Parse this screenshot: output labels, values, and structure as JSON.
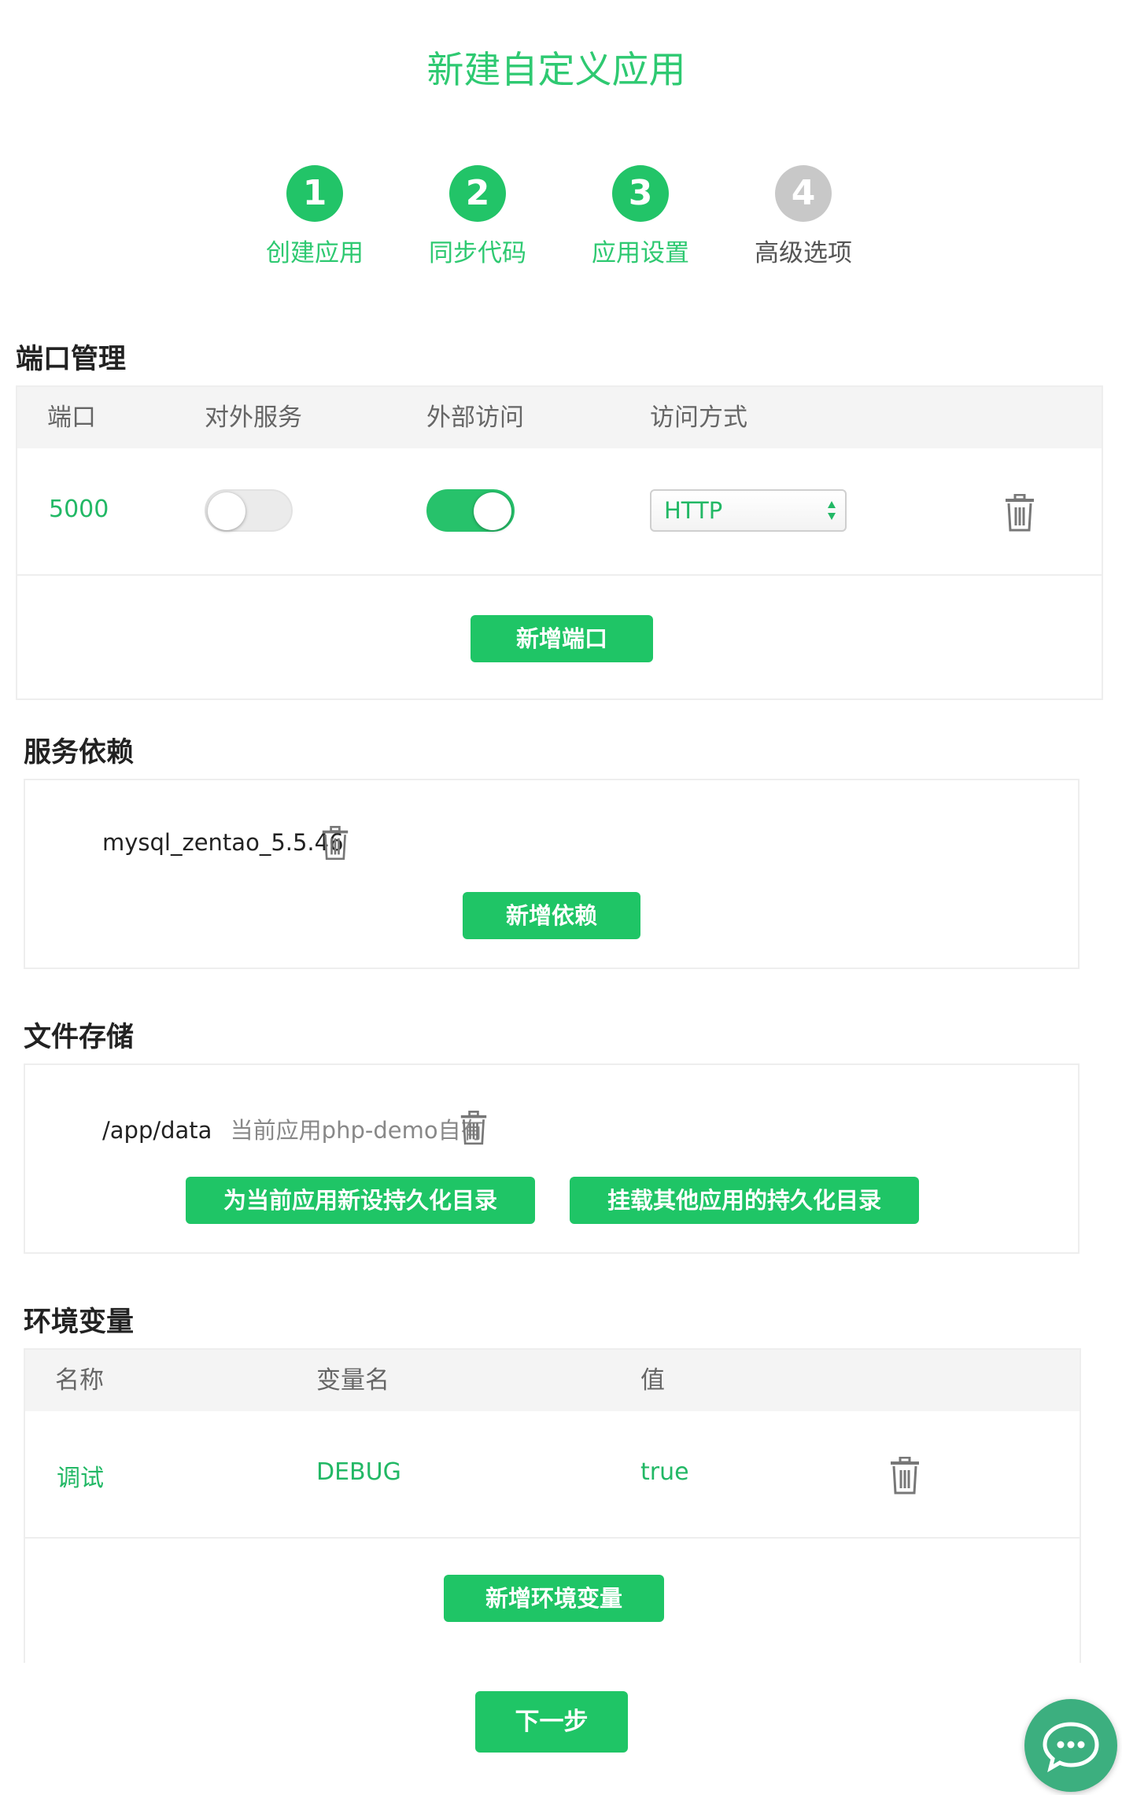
{
  "page": {
    "title": "新建自定义应用"
  },
  "steps": [
    {
      "number": "1",
      "label": "创建应用",
      "state": "done"
    },
    {
      "number": "2",
      "label": "同步代码",
      "state": "done"
    },
    {
      "number": "3",
      "label": "应用设置",
      "state": "done"
    },
    {
      "number": "4",
      "label": "高级选项",
      "state": "todo"
    }
  ],
  "ports": {
    "title": "端口管理",
    "headers": [
      "端口",
      "对外服务",
      "外部访问",
      "访问方式"
    ],
    "rows": [
      {
        "port": "5000",
        "external_service": false,
        "external_access": true,
        "protocol": "HTTP"
      }
    ],
    "add_button": "新增端口"
  },
  "dependencies": {
    "title": "服务依赖",
    "items": [
      {
        "name": "mysql_zentao_5.5.46"
      }
    ],
    "add_button": "新增依赖"
  },
  "storage": {
    "title": "文件存储",
    "items": [
      {
        "path": "/app/data",
        "note": "当前应用php-demo自有"
      }
    ],
    "new_button": "为当前应用新设持久化目录",
    "mount_button": "挂载其他应用的持久化目录"
  },
  "env": {
    "title": "环境变量",
    "headers": [
      "名称",
      "变量名",
      "值"
    ],
    "rows": [
      {
        "name": "调试",
        "var": "DEBUG",
        "value": "true"
      }
    ],
    "add_button": "新增环境变量"
  },
  "footer": {
    "next_button": "下一步"
  },
  "colors": {
    "accent": "#1fc566",
    "accent_text": "#22b865",
    "step_todo": "#c8c8c8"
  },
  "icons": {
    "delete": "trash-icon",
    "chat": "chat-bubble-icon",
    "select_arrows": "updown-arrows-icon"
  }
}
